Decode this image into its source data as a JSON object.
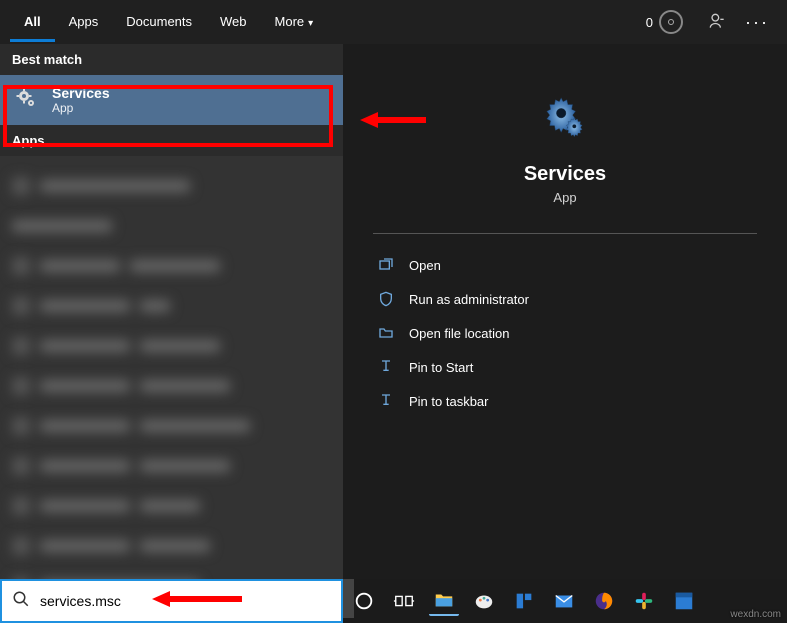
{
  "tabs": {
    "all": "All",
    "apps": "Apps",
    "documents": "Documents",
    "web": "Web",
    "more": "More",
    "reward_count": "0"
  },
  "left": {
    "best_match_label": "Best match",
    "services_title": "Services",
    "services_sub": "App",
    "apps_label": "Apps"
  },
  "preview": {
    "title": "Services",
    "sub": "App"
  },
  "actions": {
    "open": "Open",
    "admin": "Run as administrator",
    "location": "Open file location",
    "pin_start": "Pin to Start",
    "pin_taskbar": "Pin to taskbar"
  },
  "search": {
    "value": "services.msc"
  },
  "watermark": "wexdn.com"
}
